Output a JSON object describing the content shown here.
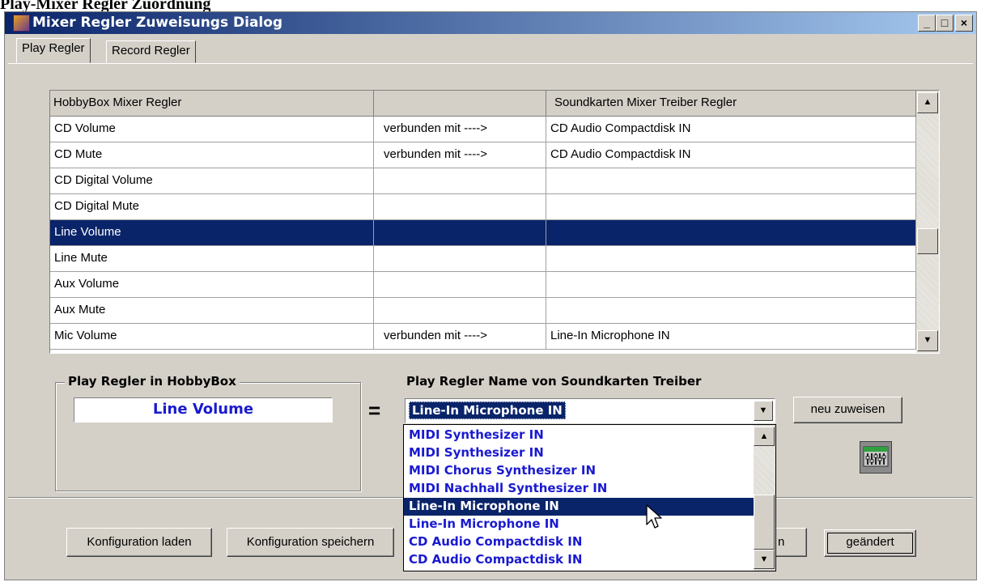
{
  "top_caption": "Play-Mixer Regler Zuordnung",
  "window": {
    "title": "Mixer Regler  Zuweisungs  Dialog",
    "minimize": "_",
    "maximize": "□",
    "close": "×"
  },
  "tabs": [
    {
      "label": "Play Regler",
      "active": true
    },
    {
      "label": "Record Regler",
      "active": false
    }
  ],
  "grid": {
    "headers": [
      "HobbyBox Mixer Regler",
      "",
      "Soundkarten Mixer Treiber Regler"
    ],
    "rows": [
      {
        "hobbybox": "CD Volume",
        "link": "verbunden mit ---->",
        "driver": "CD Audio Compactdisk IN",
        "selected": false
      },
      {
        "hobbybox": "CD Mute",
        "link": "verbunden mit ---->",
        "driver": "CD Audio Compactdisk IN",
        "selected": false
      },
      {
        "hobbybox": "CD Digital Volume",
        "link": "",
        "driver": "",
        "selected": false
      },
      {
        "hobbybox": "CD Digital Mute",
        "link": "",
        "driver": "",
        "selected": false
      },
      {
        "hobbybox": "Line Volume",
        "link": "",
        "driver": "",
        "selected": true
      },
      {
        "hobbybox": "Line Mute",
        "link": "",
        "driver": "",
        "selected": false
      },
      {
        "hobbybox": "Aux Volume",
        "link": "",
        "driver": "",
        "selected": false
      },
      {
        "hobbybox": "Aux Mute",
        "link": "",
        "driver": "",
        "selected": false
      },
      {
        "hobbybox": "Mic Volume",
        "link": "verbunden mit ---->",
        "driver": "Line-In Microphone IN",
        "selected": false
      }
    ]
  },
  "play_group": {
    "label": "Play  Regler  in  HobbyBox",
    "value": "Line Volume"
  },
  "equals": "=",
  "driver_label": "Play Regler Name von Soundkarten Treiber",
  "combo": {
    "value": "Line-In Microphone IN",
    "options": [
      {
        "label": "MIDI Synthesizer IN",
        "selected": false
      },
      {
        "label": "MIDI Synthesizer IN",
        "selected": false
      },
      {
        "label": "MIDI Chorus Synthesizer IN",
        "selected": false
      },
      {
        "label": "MIDI Nachhall Synthesizer IN",
        "selected": false
      },
      {
        "label": "Line-In Microphone IN",
        "selected": true
      },
      {
        "label": "Line-In Microphone IN",
        "selected": false
      },
      {
        "label": "CD Audio Compactdisk IN",
        "selected": false
      },
      {
        "label": "CD Audio Compactdisk IN",
        "selected": false
      }
    ]
  },
  "buttons": {
    "assign": "neu zuweisen",
    "load": "Konfiguration laden",
    "save": "Konfiguration speichern",
    "hidden_partial": "n",
    "changed": "geändert"
  },
  "icons": {
    "app": "mixer-app-icon",
    "mixer": "mixer-console-icon",
    "cursor": "mouse-pointer-icon"
  },
  "colors": {
    "titlebar": "#0a246a",
    "selection": "#0a246a",
    "link_text": "#1a1ad0",
    "face": "#d4d0c8"
  }
}
